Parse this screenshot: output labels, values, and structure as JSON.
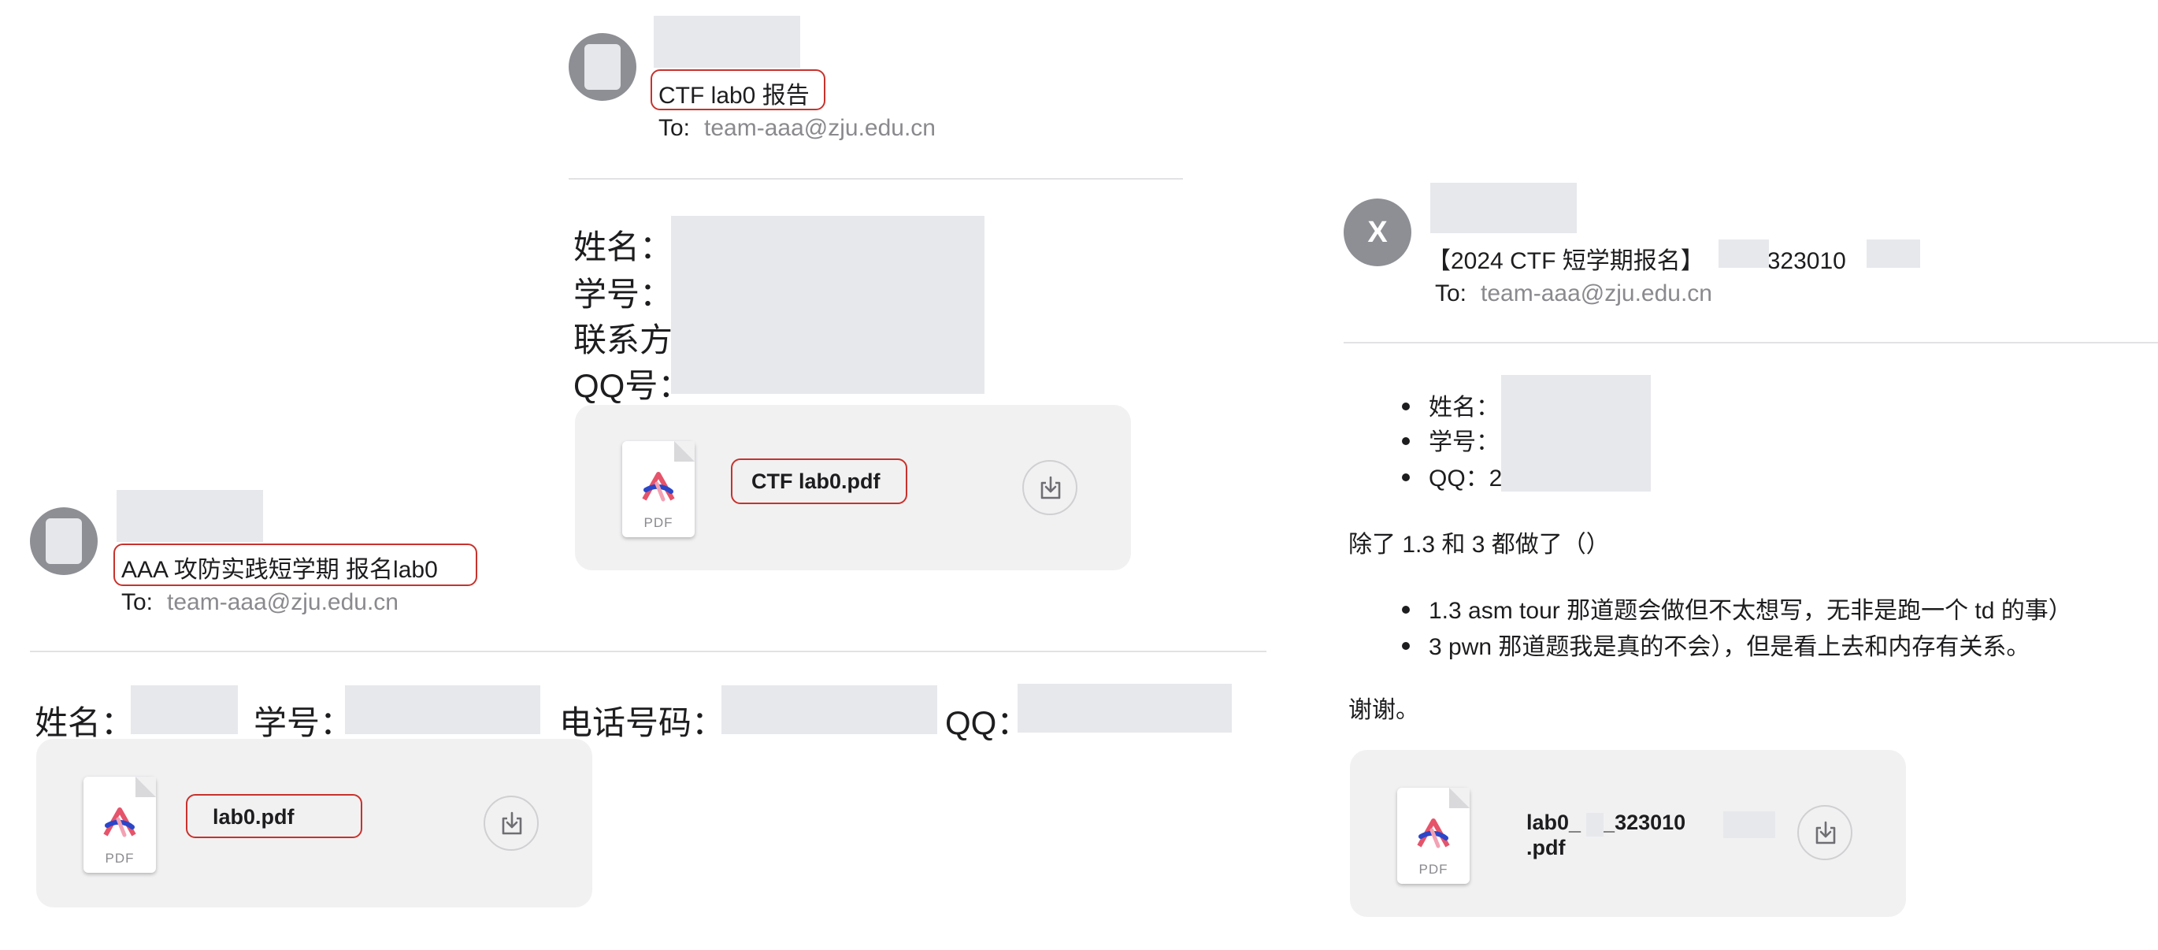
{
  "emails": {
    "top": {
      "subject": "CTF lab0 报告",
      "to_label": "To:",
      "to_address": "team-aaa@zju.edu.cn",
      "body_lines": [
        "姓名：",
        "学号：",
        "联系方",
        "QQ号："
      ],
      "attachment": {
        "filename": "CTF lab0.pdf",
        "type_label": "PDF"
      }
    },
    "left": {
      "subject": "AAA 攻防实践短学期 报名lab0",
      "to_label": "To:",
      "to_address": "team-aaa@zju.edu.cn",
      "fields": [
        "姓名：",
        "学号：",
        "电话号码：",
        "QQ："
      ],
      "attachment": {
        "filename": "lab0.pdf",
        "type_label": "PDF"
      }
    },
    "right": {
      "avatar_letter": "X",
      "subject_prefix": "【2024 CTF 短学期报名】",
      "subject_id": "323010",
      "to_label": "To:",
      "to_address": "team-aaa@zju.edu.cn",
      "info_items": [
        "姓名：",
        "学号：",
        "QQ：2"
      ],
      "intro": "除了 1.3 和 3 都做了（）",
      "notes": [
        "1.3 asm tour 那道题会做但不太想写，无非是跑一个 td 的事）",
        "3 pwn 那道题我是真的不会），但是看上去和内存有关系。"
      ],
      "thanks": "谢谢。",
      "attachment": {
        "filename_line1": "lab0_",
        "filename_mid": "_323010",
        "filename_line2": ".pdf",
        "type_label": "PDF"
      }
    }
  },
  "icons": {
    "file": "pdf-file-icon",
    "download": "download-icon"
  },
  "colors": {
    "highlight": "#c8322c",
    "redaction": "#e7e8ec",
    "card": "#f1f1f2",
    "muted": "#8a8a8e"
  }
}
